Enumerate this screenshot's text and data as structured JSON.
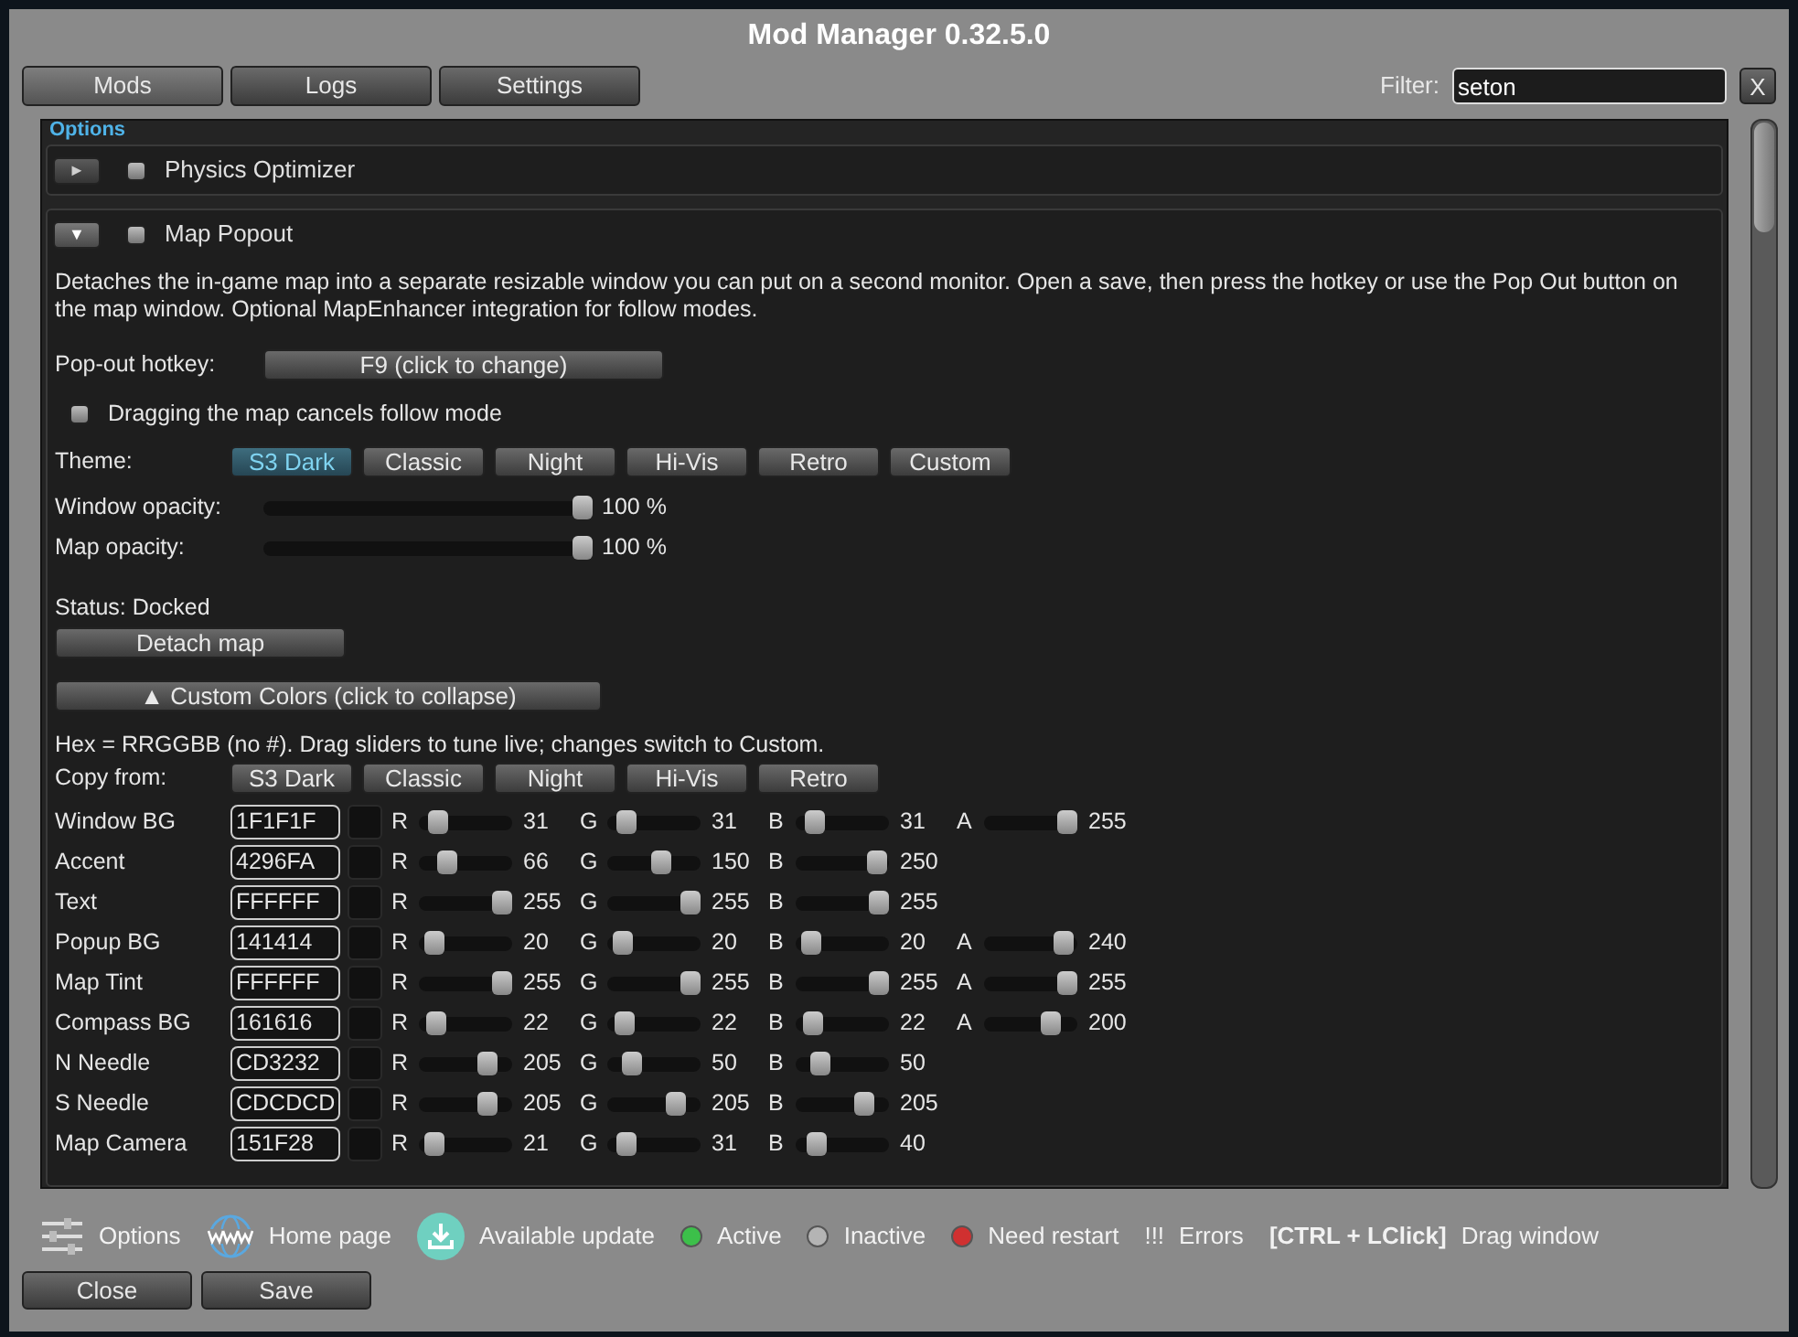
{
  "window": {
    "title": "Mod Manager 0.32.5.0"
  },
  "tabs": [
    {
      "label": "Mods",
      "selected": true
    },
    {
      "label": "Logs",
      "selected": false
    },
    {
      "label": "Settings",
      "selected": false
    }
  ],
  "filter": {
    "label": "Filter:",
    "value": "seton",
    "clear": "X"
  },
  "section_header": "Options",
  "mods": [
    {
      "name": "Physics Optimizer",
      "toggle": "►",
      "expanded": false,
      "checked": false
    },
    {
      "name": "Map Popout",
      "toggle": "▼",
      "expanded": true,
      "checked": false
    }
  ],
  "details": {
    "description": "Detaches the in-game map into a separate resizable window you can put on a second monitor. Open a save, then press the hotkey or use the Pop Out button on the map window. Optional MapEnhancer integration for follow modes.",
    "hotkey": {
      "label": "Pop-out hotkey:",
      "button": "F9  (click to change)"
    },
    "option": {
      "label": "Dragging the map cancels follow mode",
      "checked": false
    },
    "theme": {
      "label": "Theme:",
      "options": [
        {
          "label": "S3 Dark",
          "selected": true
        },
        {
          "label": "Classic",
          "selected": false
        },
        {
          "label": "Night",
          "selected": false
        },
        {
          "label": "Hi-Vis",
          "selected": false
        },
        {
          "label": "Retro",
          "selected": false
        },
        {
          "label": "Custom",
          "selected": false
        }
      ]
    },
    "sliders": [
      {
        "label": "Window opacity:",
        "level": 1,
        "reading": "100 %"
      },
      {
        "label": "Map opacity:",
        "level": 1,
        "reading": "100 %"
      }
    ],
    "status": "Status: Docked",
    "detach_button": "Detach map",
    "custom_toggle": "▲  Custom Colors  (click to collapse)",
    "hint": "Hex = RRGGBB (no #).  Drag sliders to tune live; changes switch to Custom.",
    "copy_from": {
      "label": "Copy from:",
      "options": [
        "S3 Dark",
        "Classic",
        "Night",
        "Hi-Vis",
        "Retro"
      ]
    },
    "colors": [
      {
        "name": "Window BG",
        "hex": "1F1F1F",
        "channels": [
          {
            "label": "R",
            "level": 0.12,
            "reading": "31"
          },
          {
            "label": "G",
            "level": 0.12,
            "reading": "31"
          },
          {
            "label": "B",
            "level": 0.12,
            "reading": "31"
          },
          {
            "label": "A",
            "level": 1,
            "reading": "255"
          }
        ]
      },
      {
        "name": "Accent",
        "hex": "4296FA",
        "channels": [
          {
            "label": "R",
            "level": 0.26,
            "reading": "66"
          },
          {
            "label": "G",
            "level": 0.59,
            "reading": "150"
          },
          {
            "label": "B",
            "level": 0.98,
            "reading": "250"
          }
        ]
      },
      {
        "name": "Text",
        "hex": "FFFFFF",
        "channels": [
          {
            "label": "R",
            "level": 1,
            "reading": "255"
          },
          {
            "label": "G",
            "level": 1,
            "reading": "255"
          },
          {
            "label": "B",
            "level": 1,
            "reading": "255"
          }
        ]
      },
      {
        "name": "Popup BG",
        "hex": "141414",
        "channels": [
          {
            "label": "R",
            "level": 0.08,
            "reading": "20"
          },
          {
            "label": "G",
            "level": 0.08,
            "reading": "20"
          },
          {
            "label": "B",
            "level": 0.08,
            "reading": "20"
          },
          {
            "label": "A",
            "level": 0.94,
            "reading": "240"
          }
        ]
      },
      {
        "name": "Map Tint",
        "hex": "FFFFFF",
        "channels": [
          {
            "label": "R",
            "level": 1,
            "reading": "255"
          },
          {
            "label": "G",
            "level": 1,
            "reading": "255"
          },
          {
            "label": "B",
            "level": 1,
            "reading": "255"
          },
          {
            "label": "A",
            "level": 1,
            "reading": "255"
          }
        ]
      },
      {
        "name": "Compass BG",
        "hex": "161616",
        "channels": [
          {
            "label": "R",
            "level": 0.09,
            "reading": "22"
          },
          {
            "label": "G",
            "level": 0.09,
            "reading": "22"
          },
          {
            "label": "B",
            "level": 0.09,
            "reading": "22"
          },
          {
            "label": "A",
            "level": 0.78,
            "reading": "200"
          }
        ]
      },
      {
        "name": "N Needle",
        "hex": "CD3232",
        "channels": [
          {
            "label": "R",
            "level": 0.8,
            "reading": "205"
          },
          {
            "label": "G",
            "level": 0.2,
            "reading": "50"
          },
          {
            "label": "B",
            "level": 0.2,
            "reading": "50"
          }
        ]
      },
      {
        "name": "S Needle",
        "hex": "CDCDCD",
        "channels": [
          {
            "label": "R",
            "level": 0.8,
            "reading": "205"
          },
          {
            "label": "G",
            "level": 0.8,
            "reading": "205"
          },
          {
            "label": "B",
            "level": 0.8,
            "reading": "205"
          }
        ]
      },
      {
        "name": "Map Camera",
        "hex": "151F28",
        "channels": [
          {
            "label": "R",
            "level": 0.08,
            "reading": "21"
          },
          {
            "label": "G",
            "level": 0.12,
            "reading": "31"
          },
          {
            "label": "B",
            "level": 0.16,
            "reading": "40"
          }
        ]
      }
    ]
  },
  "legend": [
    {
      "kind": "settings",
      "label": "Options"
    },
    {
      "kind": "web",
      "label": "Home page"
    },
    {
      "kind": "download",
      "label": "Available update"
    },
    {
      "kind": "status",
      "color": "#3cc04a",
      "label": "Active"
    },
    {
      "kind": "status",
      "color": "#b4b4b4",
      "label": "Inactive"
    },
    {
      "kind": "status",
      "color": "#d03030",
      "label": "Need restart"
    },
    {
      "kind": "mark",
      "mark": "!!!",
      "label": "Errors"
    },
    {
      "kind": "shortcut",
      "mark": "[CTRL + LClick]",
      "label": "Drag window"
    }
  ],
  "buttons": [
    "Close",
    "Save"
  ]
}
